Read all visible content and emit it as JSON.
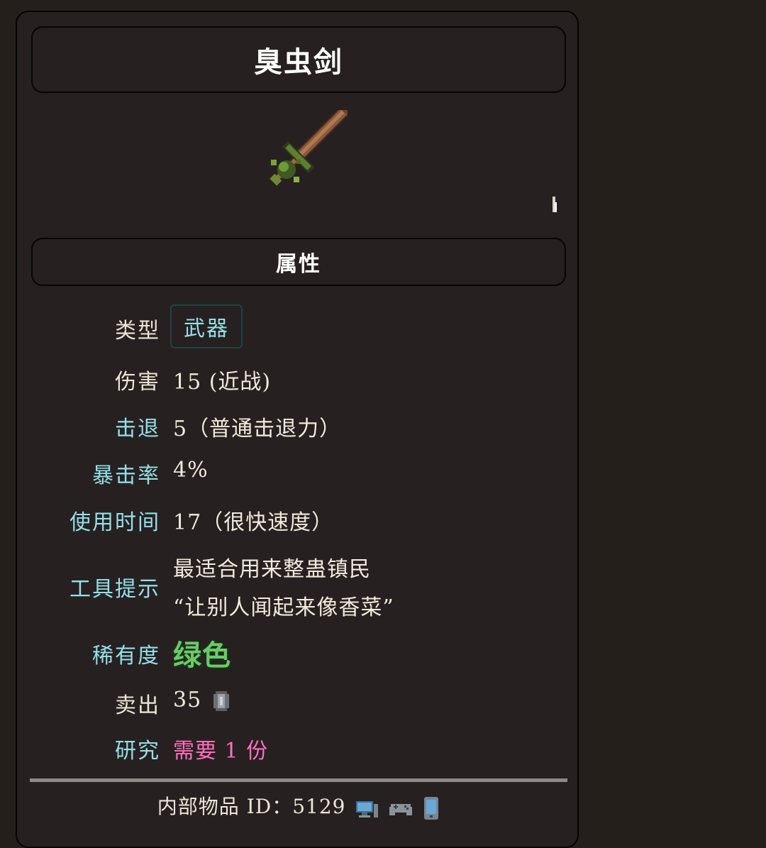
{
  "item": {
    "name": "臭虫剑"
  },
  "section": {
    "title": "属性"
  },
  "stats": {
    "type_label": "类型",
    "type_value": "武器",
    "damage_label": "伤害",
    "damage_value": "15 (近战)",
    "knockback_label": "击退",
    "knockback_value": "5（普通击退力）",
    "crit_label": "暴击率",
    "crit_value": "4%",
    "usetime_label": "使用时间",
    "usetime_value": "17（很快速度）",
    "tooltip_label": "工具提示",
    "tooltip_line1": "最适合用来整蛊镇民",
    "tooltip_line2": "“让别人闻起来像香菜”",
    "rarity_label": "稀有度",
    "rarity_value": "绿色",
    "sell_label": "卖出",
    "sell_value": "35",
    "research_label": "研究",
    "research_value": "需要 1 份"
  },
  "footer": {
    "id_label": "内部物品 ID：",
    "id_value": "5129"
  },
  "icons": {
    "coin": "silver-coin-icon",
    "platforms": [
      "desktop-icon",
      "gamepad-icon",
      "mobile-icon"
    ]
  },
  "colors": {
    "background": "#251f1c",
    "label_cyan": "#93e0e8",
    "rarity_green": "#6fc86b",
    "research_pink": "#ff6fbf"
  }
}
